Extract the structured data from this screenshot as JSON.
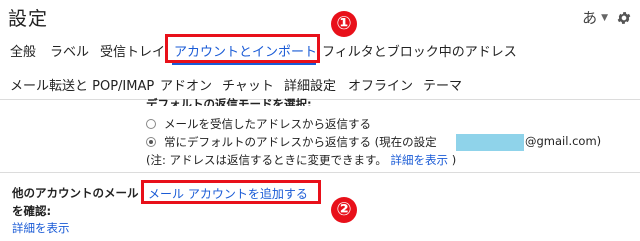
{
  "header": {
    "title": "設定",
    "input_tools_label": "あ",
    "settings_icon": "gear-icon"
  },
  "markers": {
    "one": "①",
    "two": "②"
  },
  "tabs_row1": [
    {
      "label": "全般"
    },
    {
      "label": "ラベル"
    },
    {
      "label": "受信トレイ"
    },
    {
      "label": "アカウントとインポート",
      "active": true
    },
    {
      "label": "フィルタとブロック中のアドレス"
    }
  ],
  "tabs_row2": [
    {
      "label": "メール転送と POP/IMAP"
    },
    {
      "label": "アドオン"
    },
    {
      "label": "チャット"
    },
    {
      "label": "詳細設定"
    },
    {
      "label": "オフライン"
    },
    {
      "label": "テーマ"
    }
  ],
  "reply_section": {
    "heading": "デフォルトの返信モードを選択:",
    "option1": "メールを受信したアドレスから返信する",
    "option2_prefix": "常にデフォルトのアドレスから返信する (現在の設定",
    "option2_suffix": "@gmail.com)",
    "note_prefix": "(注: アドレスは返信するときに変更できます。",
    "note_link": "詳細を表示",
    "note_suffix": ")"
  },
  "other_accounts": {
    "label_line1": "他のアカウントのメール",
    "label_line2": "を確認:",
    "details_link": "詳細を表示",
    "add_account_link": "メール アカウントを追加する"
  },
  "colors": {
    "accent": "#1a5bd6",
    "annotation_red": "#e8101a",
    "masked_email": "#8fd3ea"
  }
}
